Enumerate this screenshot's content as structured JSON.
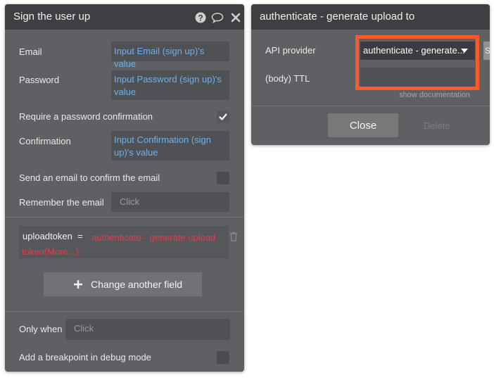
{
  "left_panel": {
    "title": "Sign the user up",
    "fields": {
      "email_label": "Email",
      "email_value": "Input Email (sign up)'s value",
      "password_label": "Password",
      "password_value": "Input Password (sign up)'s value",
      "require_confirm_label": "Require a password confirmation",
      "require_confirm_checked": true,
      "confirmation_label": "Confirmation",
      "confirmation_value": "Input Confirmation (sign up)'s value",
      "send_email_label": "Send an email to confirm the email",
      "send_email_checked": false,
      "remember_email_label": "Remember the email",
      "remember_email_placeholder": "Click"
    },
    "custom_field": {
      "key": "uploadtoken",
      "operator": "=",
      "value": "authenticate - generate upload token(More...)"
    },
    "change_field_button": "Change another field",
    "only_when_label": "Only when",
    "only_when_placeholder": "Click",
    "breakpoint_label": "Add a breakpoint in debug mode",
    "breakpoint_checked": false
  },
  "right_panel": {
    "title": "authenticate - generate upload to",
    "api_provider_label": "API provider",
    "api_provider_value": "authenticate - generate...",
    "side_button_partial": "S",
    "ttl_label": "(body) TTL",
    "ttl_value": "",
    "show_documentation": "show documentation",
    "close_button": "Close",
    "delete_button": "Delete"
  },
  "colors": {
    "panel_bg": "#5e6063",
    "header_bg": "#3d3f42",
    "link_blue": "#6db1f0",
    "expression_red": "#e8384f",
    "highlight_orange": "#fb5a2a"
  },
  "icons": [
    "help-icon",
    "comment-icon",
    "close-icon",
    "checkmark-icon",
    "trash-icon",
    "plus-icon",
    "dropdown-caret-icon"
  ]
}
